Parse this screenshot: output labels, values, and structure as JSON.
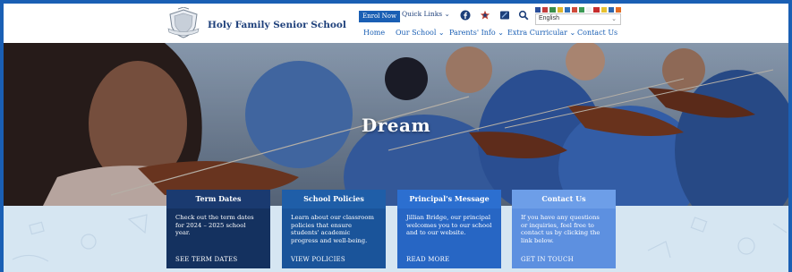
{
  "header": {
    "school_name": "Holy Family Senior School",
    "enrol_label": "Enrol Now",
    "quick_links_label": "Quick Links ⌄",
    "language": "English"
  },
  "nav": {
    "items": [
      {
        "label": "Home"
      },
      {
        "label": "Our School ⌄"
      },
      {
        "label": "Parents' Info ⌄"
      },
      {
        "label": "Extra Curricular ⌄"
      },
      {
        "label": "Contact Us"
      }
    ]
  },
  "hero": {
    "title": "Dream"
  },
  "cards": [
    {
      "title": "Term Dates",
      "body": "Check out the term dates for 2024 – 2025 school year.",
      "link": "SEE TERM DATES"
    },
    {
      "title": "School Policies",
      "body": "Learn about our classroom policies that ensure students' academic progress and well-being.",
      "link": "VIEW POLICIES"
    },
    {
      "title": "Principal's Message",
      "body": "Jillian Bridge, our principal welcomes you to our school and to our website.",
      "link": "READ MORE"
    },
    {
      "title": "Contact Us",
      "body": "If you have any questions or inquiries, feel free to contact us by clicking the link below.",
      "link": "GET IN TOUCH"
    }
  ],
  "icons": {
    "facebook": "facebook-icon",
    "star": "star-icon",
    "book": "book-icon",
    "search": "search-icon"
  },
  "colors": {
    "brand_blue": "#1a5fb4",
    "navy": "#1d3f7a"
  }
}
